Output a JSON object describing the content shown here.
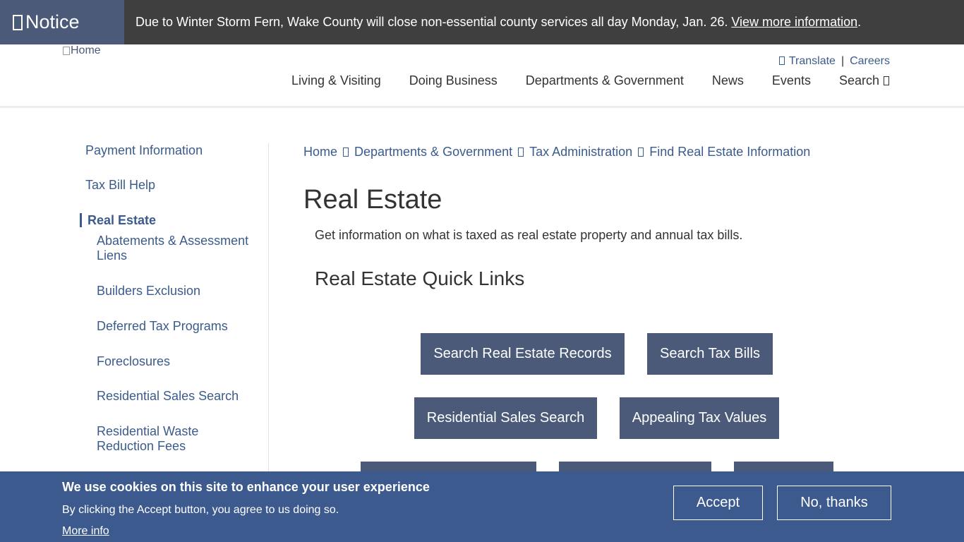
{
  "notice": {
    "label": "Notice",
    "message": "Due to Winter Storm Fern, Wake County will close non-essential county services all day Monday, Jan. 26. ",
    "link_text": "View more information",
    "period": "."
  },
  "header": {
    "logo_alt": "Home",
    "utility": {
      "translate": "Translate",
      "separator": "|",
      "careers": "Careers"
    },
    "nav": [
      "Living & Visiting",
      "Doing Business",
      "Departments & Government",
      "News",
      "Events",
      "Search"
    ]
  },
  "sidebar": {
    "items": [
      "Payment Information",
      "Tax Bill Help",
      "Real Estate",
      "Abatements & Assessment Liens",
      "Builders Exclusion",
      "Deferred Tax Programs",
      "Foreclosures",
      "Residential Sales Search",
      "Residential Waste Reduction Fees"
    ]
  },
  "breadcrumb": [
    "Home",
    "Departments & Government",
    "Tax Administration",
    "Find Real Estate Information"
  ],
  "main": {
    "title": "Real Estate",
    "intro": "Get information on what is taxed as real estate property and annual tax bills.",
    "quick_links_title": "Real Estate Quick Links",
    "quick_links": [
      "Search Real Estate Records",
      "Search Tax Bills",
      "Residential Sales Search",
      "Appealing Tax Values"
    ]
  },
  "cookie": {
    "title": "We use cookies on this site to enhance your user experience",
    "text": "By clicking the Accept button, you agree to us doing so.",
    "more_info": "More info",
    "accept": "Accept",
    "decline": "No, thanks"
  },
  "colors": {
    "accent": "#4b5a78",
    "link": "#3b5b8c",
    "notice_bg": "#3f3f3f",
    "cookie_bg": "#3d5a8e"
  }
}
